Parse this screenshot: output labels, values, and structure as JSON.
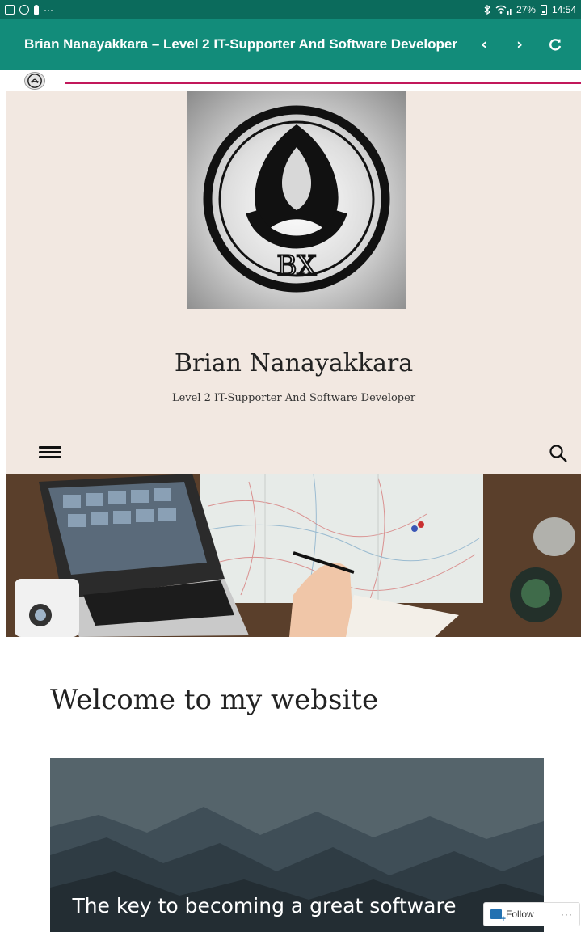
{
  "status_bar": {
    "signal_text": "27%",
    "time": "14:54",
    "left_dots": "···"
  },
  "app_bar": {
    "title": "Brian Nanayakkara – Level 2 IT-Supporter And Software Developer",
    "back_glyph": "‹",
    "forward_glyph": "›",
    "refresh_glyph": "C"
  },
  "progress": {
    "accent_color": "#c2185b",
    "value_percent": 100
  },
  "header": {
    "logo_letters": "BX",
    "site_title": "Brian Nanayakkara",
    "tagline": "Level 2 IT-Supporter And Software Developer"
  },
  "content": {
    "heading": "Welcome to my website",
    "feature_caption": "The key to becoming a great software"
  },
  "follow_bar": {
    "follow_label": "Follow",
    "more_label": "···"
  },
  "colors": {
    "status_bar": "#0b6b5c",
    "app_bar": "#128c7a",
    "header_bg": "#f2e8e1"
  },
  "icons": [
    "status-image-icon",
    "status-circle-icon",
    "status-person-icon",
    "bluetooth-icon",
    "wifi-icon",
    "battery-icon",
    "back-icon",
    "forward-icon",
    "refresh-icon",
    "favicon-icon",
    "hamburger-menu-icon",
    "search-icon",
    "follow-icon"
  ]
}
